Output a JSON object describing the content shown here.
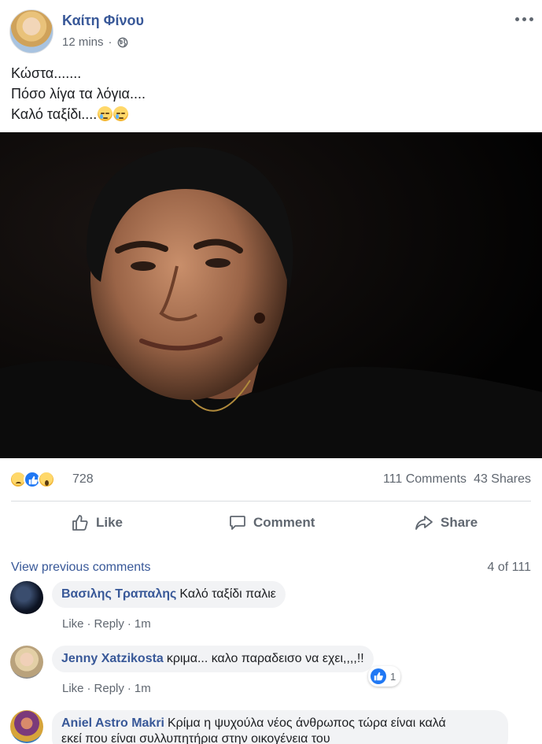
{
  "post": {
    "author": "Καίτη Φίνου",
    "time": "12 mins",
    "separator": "·",
    "privacy_icon": "globe-icon",
    "more_icon": "more-dots-icon",
    "text_lines": [
      "Κώστα.......",
      "Πόσο λίγα τα λόγια....",
      "Καλό ταξίδι...."
    ],
    "text_emojis": [
      "sad-tear-emoji",
      "sad-tear-emoji"
    ]
  },
  "reactions": {
    "icons": [
      "sad-reaction",
      "like-reaction",
      "wow-reaction"
    ],
    "count": "728",
    "comments": "111 Comments",
    "shares": "43 Shares"
  },
  "actions": {
    "like": "Like",
    "comment": "Comment",
    "share": "Share"
  },
  "comments_section": {
    "view_previous": "View previous comments",
    "count": "4 of 111",
    "items": [
      {
        "name": "Βασιλης Τραπαλης",
        "text": "Καλό ταξίδι παλιε",
        "like": "Like",
        "reply": "Reply",
        "time": "1m"
      },
      {
        "name": "Jenny Xatzikosta",
        "text": "κριμα... καλο παραδεισο να εχει,,,,!!",
        "like": "Like",
        "reply": "Reply",
        "time": "1m",
        "likes": "1"
      },
      {
        "name": "Aniel Astro Makri",
        "text": "Κρίμα η ψυχούλα νέος άνθρωπος τώρα είναι καλά",
        "text2": "εκεί που είναι συλλυπητήρια στην οικογένεια του"
      }
    ]
  },
  "colors": {
    "link": "#385898",
    "muted": "#606770",
    "bubble": "#f2f3f5",
    "like_blue": "#2078f4"
  }
}
